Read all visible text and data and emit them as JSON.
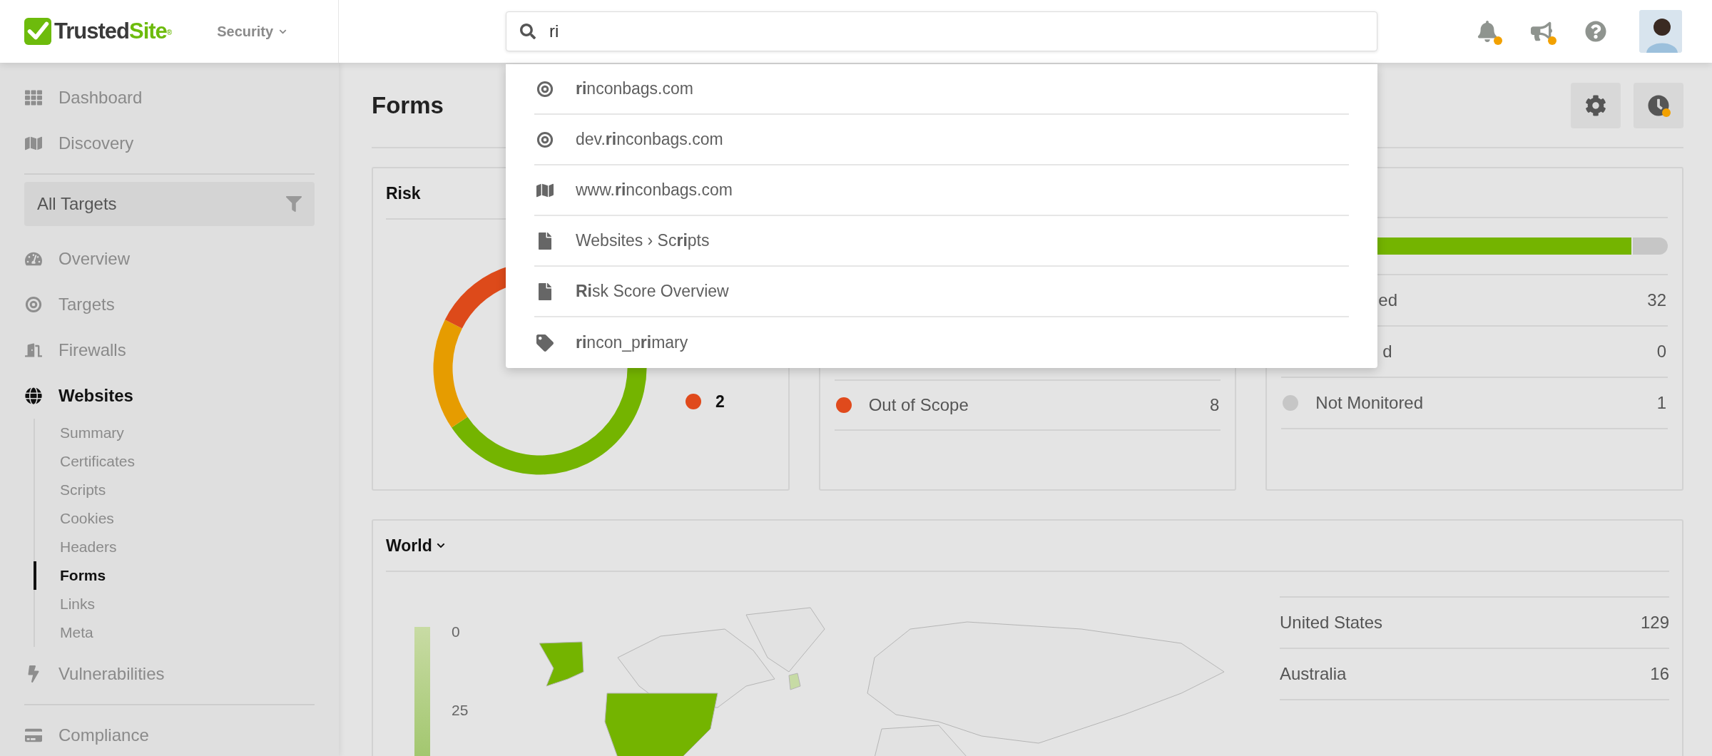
{
  "top_bar": {
    "logo": {
      "part_1": "Trusted",
      "part_2": "Site",
      "mark": "®"
    },
    "product_menu": "Security",
    "search": {
      "value": "ri"
    },
    "actions": [
      {
        "kind": "bell",
        "badge": true
      },
      {
        "kind": "megaphone",
        "badge": true
      },
      {
        "kind": "help",
        "badge": false
      }
    ]
  },
  "search_results": [
    {
      "kind": "target",
      "text": "**ri**nconbags.com"
    },
    {
      "kind": "target",
      "text": "dev.**ri**nconbags.com"
    },
    {
      "kind": "map",
      "text": "www.**ri**nconbags.com"
    },
    {
      "kind": "file",
      "text": "Websites › Sc**ri**pts"
    },
    {
      "kind": "file",
      "text": "**Ri**sk Score Overview"
    },
    {
      "kind": "tag",
      "text": "**ri**ncon_p**ri**mary"
    }
  ],
  "sidebar": {
    "nav_top": [
      {
        "label": "Dashboard",
        "kind": "grid",
        "selected": false
      },
      {
        "label": "Discovery",
        "kind": "map",
        "selected": false
      }
    ],
    "target_filter": "All Targets",
    "nav": [
      {
        "label": "Overview",
        "kind": "gauge",
        "selected": false
      },
      {
        "label": "Targets",
        "kind": "target",
        "selected": false
      },
      {
        "label": "Firewalls",
        "kind": "door",
        "selected": false
      },
      {
        "label": "Websites",
        "kind": "globe",
        "selected": true,
        "children": [
          {
            "label": "Summary",
            "selected": false
          },
          {
            "label": "Certificates",
            "selected": false
          },
          {
            "label": "Scripts",
            "selected": false
          },
          {
            "label": "Cookies",
            "selected": false
          },
          {
            "label": "Headers",
            "selected": false
          },
          {
            "label": "Forms",
            "selected": true
          },
          {
            "label": "Links",
            "selected": false
          },
          {
            "label": "Meta",
            "selected": false
          }
        ]
      },
      {
        "label": "Vulnerabilities",
        "kind": "bolt",
        "selected": false
      }
    ],
    "nav_bottom": [
      {
        "label": "Compliance",
        "kind": "card",
        "selected": false
      }
    ]
  },
  "page": {
    "title": "Forms",
    "buttons": [
      {
        "kind": "settings",
        "badge": false
      },
      {
        "kind": "history",
        "badge": true
      }
    ]
  },
  "risk_card": {
    "title": "Risk",
    "legend": [
      {
        "color": "#e04a1c",
        "value": "2"
      }
    ]
  },
  "scope_card": {
    "rows": [
      {
        "label": "Out of Scope",
        "value": "8",
        "color": "#e04a1c"
      }
    ]
  },
  "monitor_card": {
    "progress": {
      "level": 0.91
    },
    "rows": [
      {
        "kind": "cut",
        "label": "ed",
        "value": "32"
      },
      {
        "kind": "cut",
        "label": "d",
        "value": "0"
      },
      {
        "kind": "dot",
        "label": "Not Monitored",
        "value": "1",
        "color": "#c6c6c6"
      }
    ]
  },
  "world_card": {
    "title": "World",
    "legend_ticks": [
      "0",
      "25"
    ],
    "countries": [
      {
        "name": "United States",
        "value": "129"
      },
      {
        "name": "Australia",
        "value": "16"
      }
    ]
  }
}
